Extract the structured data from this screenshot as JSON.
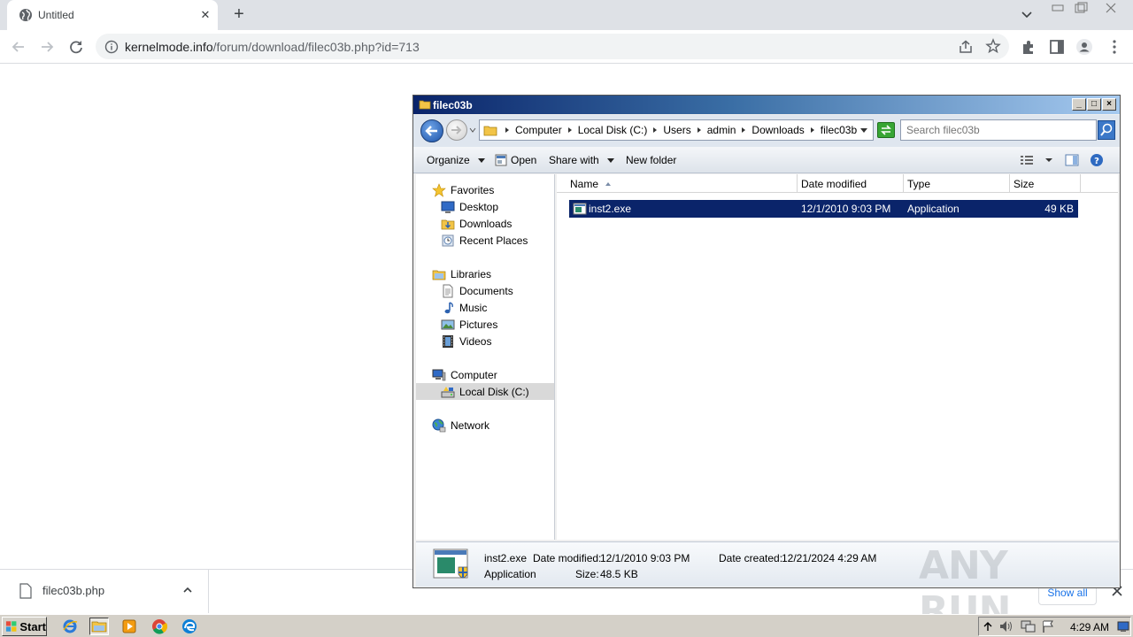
{
  "browser": {
    "tab_title": "Untitled",
    "url_host": "kernelmode.info",
    "url_path": "/forum/download/filec03b.php?id=713"
  },
  "download_bar": {
    "file_name": "filec03b.php",
    "show_all_label": "Show all"
  },
  "explorer": {
    "window_title": "filec03b",
    "breadcrumb": [
      "Computer",
      "Local Disk (C:)",
      "Users",
      "admin",
      "Downloads",
      "filec03b"
    ],
    "search_placeholder": "Search filec03b",
    "toolbar": {
      "organize": "Organize",
      "open": "Open",
      "share_with": "Share with",
      "new_folder": "New folder"
    },
    "nav": {
      "favorites": "Favorites",
      "desktop": "Desktop",
      "downloads": "Downloads",
      "recent_places": "Recent Places",
      "libraries": "Libraries",
      "documents": "Documents",
      "music": "Music",
      "pictures": "Pictures",
      "videos": "Videos",
      "computer": "Computer",
      "local_disk": "Local Disk (C:)",
      "network": "Network"
    },
    "columns": [
      "Name",
      "Date modified",
      "Type",
      "Size"
    ],
    "files": [
      {
        "name": "inst2.exe",
        "date_modified": "12/1/2010 9:03 PM",
        "type": "Application",
        "size": "49 KB"
      }
    ],
    "details": {
      "name": "inst2.exe",
      "date_modified_label": "Date modified:",
      "date_modified": "12/1/2010 9:03 PM",
      "date_created_label": "Date created:",
      "date_created": "12/21/2024 4:29 AM",
      "type": "Application",
      "size_label": "Size:",
      "size": "48.5 KB"
    }
  },
  "watermark": "ANY RUN",
  "taskbar": {
    "start_label": "Start",
    "clock": "4:29 AM"
  },
  "colors": {
    "selection": "#0a246a",
    "titlebar": "#0a246a",
    "chrome_tabstrip": "#dee1e6"
  }
}
